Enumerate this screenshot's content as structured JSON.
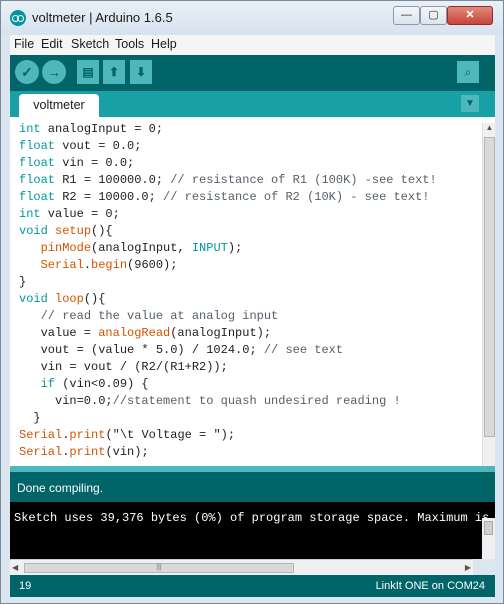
{
  "window": {
    "title": "voltmeter | Arduino 1.6.5",
    "controls": {
      "minimize": "—",
      "maximize": "▢",
      "close": "✕"
    }
  },
  "menu": [
    "File",
    "Edit",
    "Sketch",
    "Tools",
    "Help"
  ],
  "toolbar": {
    "verify_icon": "✓",
    "upload_icon": "→",
    "new_icon": "▤",
    "open_icon": "⬆",
    "save_icon": "⬇",
    "serial_icon": "⌕"
  },
  "tabs": [
    {
      "label": "voltmeter"
    }
  ],
  "tab_menu_icon": "▼",
  "code_lines": [
    [
      {
        "t": "int",
        "c": "kw"
      },
      {
        "t": " analogInput = 0;"
      }
    ],
    [
      {
        "t": "float",
        "c": "kw"
      },
      {
        "t": " vout = 0.0;"
      }
    ],
    [
      {
        "t": "float",
        "c": "kw"
      },
      {
        "t": " vin = 0.0;"
      }
    ],
    [
      {
        "t": "float",
        "c": "kw"
      },
      {
        "t": " R1 = 100000.0; "
      },
      {
        "t": "// resistance of R1 (100K) -see text!",
        "c": "cm"
      }
    ],
    [
      {
        "t": "float",
        "c": "kw"
      },
      {
        "t": " R2 = 10000.0; "
      },
      {
        "t": "// resistance of R2 (10K) - see text!",
        "c": "cm"
      }
    ],
    [
      {
        "t": "int",
        "c": "kw"
      },
      {
        "t": " value = 0;"
      }
    ],
    [
      {
        "t": "void",
        "c": "kw"
      },
      {
        "t": " "
      },
      {
        "t": "setup",
        "c": "fn"
      },
      {
        "t": "(){"
      }
    ],
    [
      {
        "t": "   "
      },
      {
        "t": "pinMode",
        "c": "fn"
      },
      {
        "t": "(analogInput, "
      },
      {
        "t": "INPUT",
        "c": "kw"
      },
      {
        "t": ");"
      }
    ],
    [
      {
        "t": "   "
      },
      {
        "t": "Serial",
        "c": "fn"
      },
      {
        "t": "."
      },
      {
        "t": "begin",
        "c": "fn"
      },
      {
        "t": "(9600);"
      }
    ],
    [
      {
        "t": "}"
      }
    ],
    [
      {
        "t": "void",
        "c": "kw"
      },
      {
        "t": " "
      },
      {
        "t": "loop",
        "c": "fn"
      },
      {
        "t": "(){"
      }
    ],
    [
      {
        "t": "   "
      },
      {
        "t": "// read the value at analog input",
        "c": "cm"
      }
    ],
    [
      {
        "t": "   value = "
      },
      {
        "t": "analogRead",
        "c": "fn"
      },
      {
        "t": "(analogInput);"
      }
    ],
    [
      {
        "t": "   vout = (value * 5.0) / 1024.0; "
      },
      {
        "t": "// see text",
        "c": "cm"
      }
    ],
    [
      {
        "t": "   vin = vout / (R2/(R1+R2));"
      }
    ],
    [
      {
        "t": "   "
      },
      {
        "t": "if",
        "c": "kw"
      },
      {
        "t": " (vin<0.09) {"
      }
    ],
    [
      {
        "t": "     vin=0.0;"
      },
      {
        "t": "//statement to quash undesired reading !",
        "c": "cm"
      }
    ],
    [
      {
        "t": "  }"
      }
    ],
    [
      {
        "t": "Serial",
        "c": "fn"
      },
      {
        "t": "."
      },
      {
        "t": "print",
        "c": "fn"
      },
      {
        "t": "(\"\\t Voltage = \");"
      }
    ],
    [
      {
        "t": "Serial",
        "c": "fn"
      },
      {
        "t": "."
      },
      {
        "t": "print",
        "c": "fn"
      },
      {
        "t": "(vin);"
      }
    ]
  ],
  "status": {
    "message": "Done compiling."
  },
  "console": {
    "text": "Sketch uses 39,376 bytes (0%) of program storage space. Maximum is"
  },
  "footer": {
    "line_number": "19",
    "board": "LinkIt ONE on COM24"
  },
  "colors": {
    "toolbar_bg": "#006468",
    "tab_bar_bg": "#17a1a5",
    "button_bg": "#4db7bb",
    "keyword": "#00979c",
    "function": "#d35400"
  }
}
